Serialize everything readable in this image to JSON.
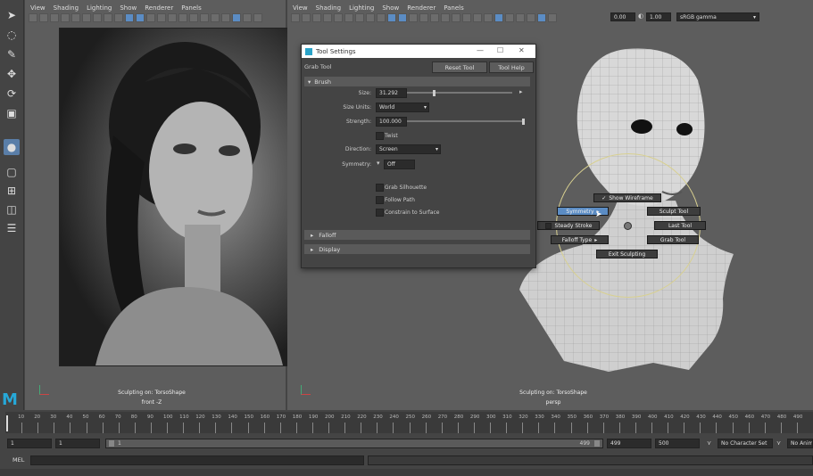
{
  "left_panel": {
    "menu": [
      "View",
      "Shading",
      "Lighting",
      "Show",
      "Renderer",
      "Panels"
    ],
    "hud_line1": "Sculpting on: TorsoShape",
    "hud_line2": "front -Z"
  },
  "right_panel": {
    "menu": [
      "View",
      "Shading",
      "Lighting",
      "Show",
      "Renderer",
      "Panels"
    ],
    "exposure": "0.00",
    "gamma": "1.00",
    "color_space": "sRGB gamma",
    "hud_line1": "Sculpting on: TorsoShape",
    "hud_line2": "persp"
  },
  "tool_settings": {
    "window_title": "Tool Settings",
    "tool_name": "Grab Tool",
    "reset_label": "Reset Tool",
    "help_label": "Tool Help",
    "brush_section": "Brush",
    "size_label": "Size:",
    "size_value": "31.292",
    "size_fraction": 0.25,
    "size_units_label": "Size Units:",
    "size_units_value": "World",
    "strength_label": "Strength:",
    "strength_value": "100.000",
    "strength_fraction": 1.0,
    "twist_label": "Twist",
    "direction_label": "Direction:",
    "direction_value": "Screen",
    "symmetry_label": "Symmetry:",
    "symmetry_value": "Off",
    "grab_silhouette": "Grab Silhouette",
    "follow_path": "Follow Path",
    "constrain_surface": "Constrain to Surface",
    "falloff_section": "Falloff",
    "display_section": "Display"
  },
  "marking_menu": {
    "show_wireframe": "Show Wireframe",
    "symmetry": "Symmetry",
    "sculpt_tool": "Sculpt Tool",
    "steady_stroke": "Steady Stroke",
    "last_tool": "Last Tool",
    "falloff_type": "Falloff Type",
    "grab_tool": "Grab Tool",
    "exit_sculpting": "Exit Sculpting"
  },
  "timeline": {
    "ticks": [
      "10",
      "20",
      "30",
      "40",
      "50",
      "60",
      "70",
      "80",
      "90",
      "100",
      "110",
      "120",
      "130",
      "140",
      "150",
      "160",
      "170",
      "180",
      "190",
      "200",
      "210",
      "220",
      "230",
      "240",
      "250",
      "260",
      "270",
      "280",
      "290",
      "300",
      "310",
      "320",
      "330",
      "340",
      "350",
      "360",
      "370",
      "380",
      "390",
      "400",
      "410",
      "420",
      "430",
      "440",
      "450",
      "460",
      "470",
      "480",
      "490"
    ],
    "start_value": "1",
    "current_value": "1",
    "range_start": "1",
    "range_end": "499",
    "end_value": "499",
    "max_value": "500",
    "character_set": "No Character Set",
    "anim_layer": "No Anim L",
    "script_lang": "MEL"
  },
  "colors": {
    "accent": "#5b8cc4",
    "viewport_bg": "#5d5d5d",
    "ui_bg": "#444444"
  }
}
